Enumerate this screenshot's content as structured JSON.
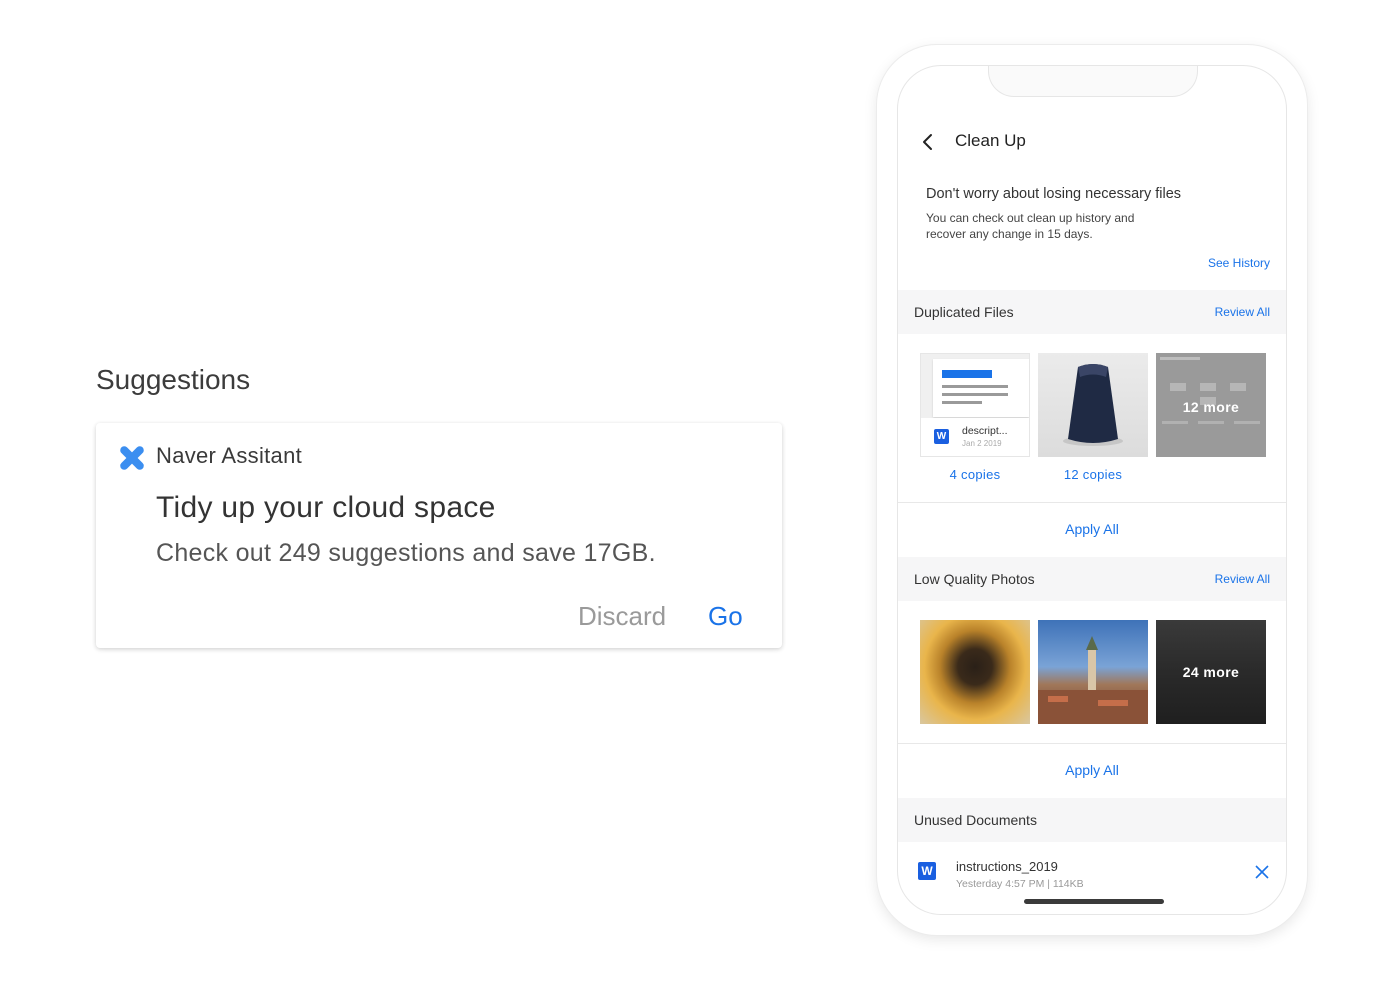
{
  "suggestions": {
    "title": "Suggestions",
    "card": {
      "assistant_name": "Naver Assitant",
      "headline": "Tidy up your cloud space",
      "subline": "Check out 249 suggestions and save 17GB.",
      "discard_label": "Discard",
      "go_label": "Go"
    }
  },
  "phone": {
    "nav": {
      "title": "Clean Up"
    },
    "intro": {
      "title": "Don't worry about losing necessary files",
      "body": "You can check out clean up history and recover any change in 15 days.",
      "see_history": "See History"
    },
    "duplicated": {
      "label": "Duplicated Files",
      "review_all": "Review All",
      "doc_name": "descript...",
      "doc_date": "Jan 2 2019",
      "items": [
        {
          "copies": "4 copies"
        },
        {
          "copies": "12 copies"
        },
        {
          "more": "12 more"
        }
      ],
      "apply_all": "Apply All"
    },
    "low_quality": {
      "label": "Low Quality Photos",
      "review_all": "Review All",
      "more": "24 more",
      "apply_all": "Apply All"
    },
    "unused": {
      "label": "Unused Documents",
      "doc": {
        "icon_letter": "W",
        "name": "instructions_2019",
        "meta": "Yesterday 4:57 PM | 114KB"
      }
    }
  },
  "colors": {
    "accent": "#1a73e8",
    "assistant_icon": "#3b8ef0",
    "word_blue": "#1a5fe0"
  }
}
